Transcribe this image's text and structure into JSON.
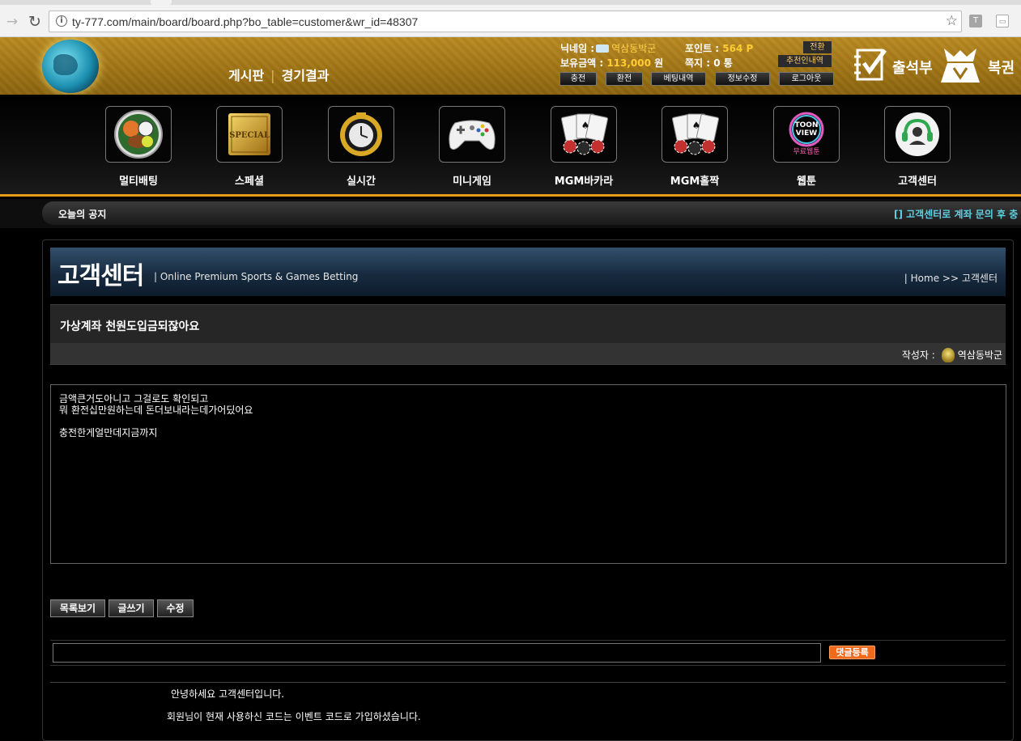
{
  "browser": {
    "url": "ty-777.com/main/board/board.php?bo_table=customer&wr_id=48307"
  },
  "topbar": {
    "nav": [
      "게시판",
      "경기결과"
    ],
    "nickname_label": "닉네임 :",
    "nickname": "역삼동박군",
    "points_label": "포인트 :",
    "points": "564 P",
    "balance_label": "보유금액 :",
    "balance": "113,000",
    "balance_unit": "원",
    "messages_label": "쪽지 :",
    "messages": "0 통",
    "convert_label": "전환",
    "referral_label": "추천인내역",
    "buttons": [
      "충전",
      "환전",
      "베팅내역",
      "정보수정",
      "로그아웃"
    ],
    "attendance_label": "출석부",
    "lottery_label": "복권"
  },
  "menu": {
    "items": [
      {
        "label": "멀티배팅",
        "icon": "sports-balls-icon"
      },
      {
        "label": "스페셜",
        "icon": "special-badge-icon"
      },
      {
        "label": "실시간",
        "icon": "live-clock-icon"
      },
      {
        "label": "미니게임",
        "icon": "gamepad-icon"
      },
      {
        "label": "MGM바카라",
        "icon": "cards-chips-icon"
      },
      {
        "label": "MGM홀짝",
        "icon": "cards-chips-icon"
      },
      {
        "label": "웹툰",
        "icon": "toon-view-icon"
      },
      {
        "label": "고객센터",
        "icon": "support-agent-icon"
      }
    ],
    "special_text": "SPECIAL",
    "toon_line1": "TOON",
    "toon_line2": "VIEW",
    "toon_sub": "무료웹툰"
  },
  "notice": {
    "title": "오늘의 공지",
    "text": "[] 고객센터로 계좌 문의 후 충"
  },
  "page": {
    "title": "고객센터",
    "subtitle": "| Online Premium Sports & Games Betting",
    "breadcrumb": "| Home >> 고객센터"
  },
  "post": {
    "title": "가상계좌 천원도입금되잖아요",
    "author_label": "작성자 :",
    "author": "역삼동박군",
    "body": [
      "금액큰거도아니고 그걸로도 확인되고",
      "뭐 환전십만원하는데 돈더보내라는데가어딨어요",
      "",
      "충전한게얼만데지금까지"
    ]
  },
  "actions": {
    "list": "목록보기",
    "write": "글쓰기",
    "edit": "수정"
  },
  "comment": {
    "value": "",
    "submit": "댓글등록"
  },
  "reply": {
    "lines": [
      "안녕하세요 고객센터입니다.",
      "회원님이 현재 사용하신 코드는 이벤트 코드로 가입하셨습니다."
    ]
  },
  "colors": {
    "gold_bar": "#9d7214",
    "menu_accent": "#e89b16",
    "header_blue": "#1e3550",
    "notice_text": "#5fd0e0",
    "comment_button": "#ef6a1c"
  }
}
